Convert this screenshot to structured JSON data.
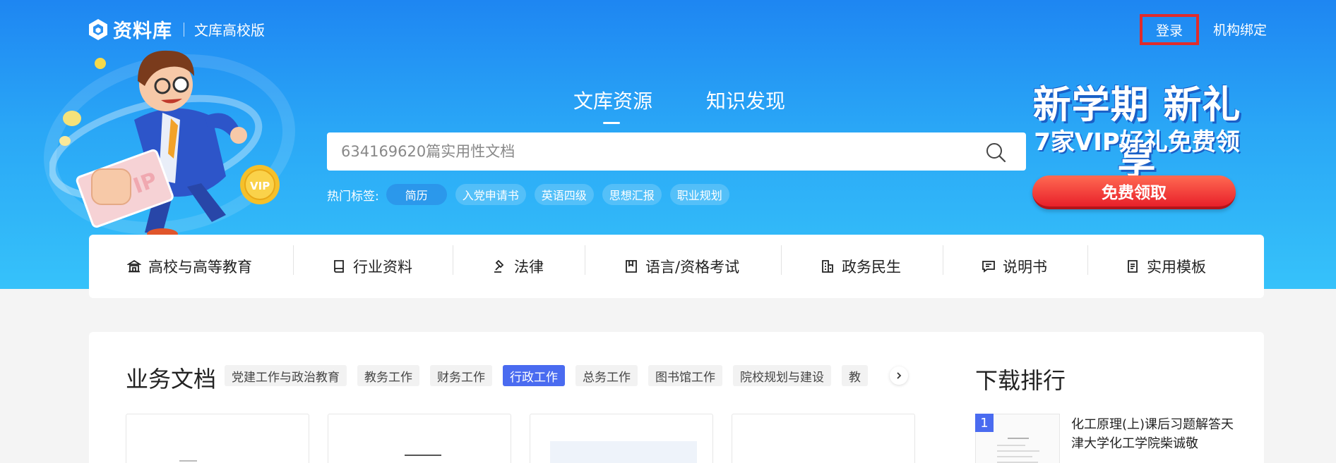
{
  "header": {
    "logo_text": "资料库",
    "logo_subtitle": "文库高校版",
    "login_label": "登录",
    "bind_label": "机构绑定"
  },
  "search": {
    "tabs": [
      {
        "label": "文库资源",
        "active": true
      },
      {
        "label": "知识发现",
        "active": false
      }
    ],
    "placeholder": "634169620篇实用性文档",
    "hot_label": "热门标签:",
    "hot_tags": [
      "简历",
      "入党申请书",
      "英语四级",
      "思想汇报",
      "职业规划"
    ]
  },
  "promo": {
    "title": "新学期 新礼享",
    "subtitle": "7家VIP好礼免费领",
    "button_label": "免费领取"
  },
  "mascot": {
    "card_text": "VIP",
    "coin_text": "VIP"
  },
  "categories": [
    {
      "label": "高校与高等教育",
      "icon": "school-icon"
    },
    {
      "label": "行业资料",
      "icon": "book-icon"
    },
    {
      "label": "法律",
      "icon": "gavel-icon"
    },
    {
      "label": "语言/资格考试",
      "icon": "bookmark-book-icon"
    },
    {
      "label": "政务民生",
      "icon": "building-icon"
    },
    {
      "label": "说明书",
      "icon": "manual-icon"
    },
    {
      "label": "实用模板",
      "icon": "template-icon"
    }
  ],
  "business": {
    "title": "业务文档",
    "filters": [
      "党建工作与政治教育",
      "教务工作",
      "财务工作",
      "行政工作",
      "总务工作",
      "图书馆工作",
      "院校规划与建设",
      "教"
    ],
    "active_filter": "行政工作"
  },
  "ranking": {
    "title": "下载排行",
    "items": [
      {
        "rank": "1",
        "title": "化工原理(上)课后习题解答天津大学化工学院柴诚敬"
      }
    ]
  },
  "colors": {
    "accent": "#4a6bf0",
    "hero_top": "#1e86f2",
    "hero_bottom": "#36c2fa",
    "promo_button": "#e8202a",
    "login_outline": "#e02b2b"
  }
}
